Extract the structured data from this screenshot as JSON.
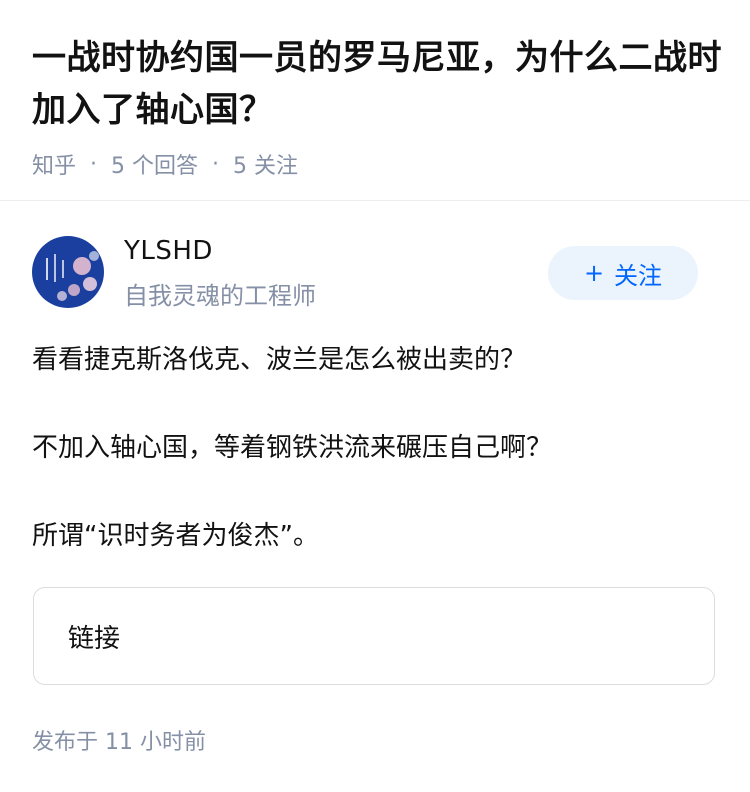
{
  "question": {
    "title": "一战时协约国一员的罗马尼亚，为什么二战时加入了轴心国？",
    "source": "知乎",
    "answers": "5 个回答",
    "followers": "5 关注"
  },
  "author": {
    "name": "YLSHD",
    "headline": "自我灵魂的工程师",
    "follow_label": "关注",
    "follow_icon": "plus-icon",
    "avatar_colors": [
      "#1b3f9e",
      "#e8bfd2",
      "#ffffff"
    ]
  },
  "content": {
    "paragraphs": [
      "看看捷克斯洛伐克、波兰是怎么被出卖的？",
      "不加入轴心国，等着钢铁洪流来碾压自己啊？",
      "所谓“识时务者为俊杰”。"
    ]
  },
  "link_card": {
    "label": "链接"
  },
  "footer": {
    "published": "发布于 11 小时前"
  },
  "colors": {
    "accent": "#0066ff",
    "accent_bg": "#ebf3fd",
    "muted": "#8590a6"
  }
}
